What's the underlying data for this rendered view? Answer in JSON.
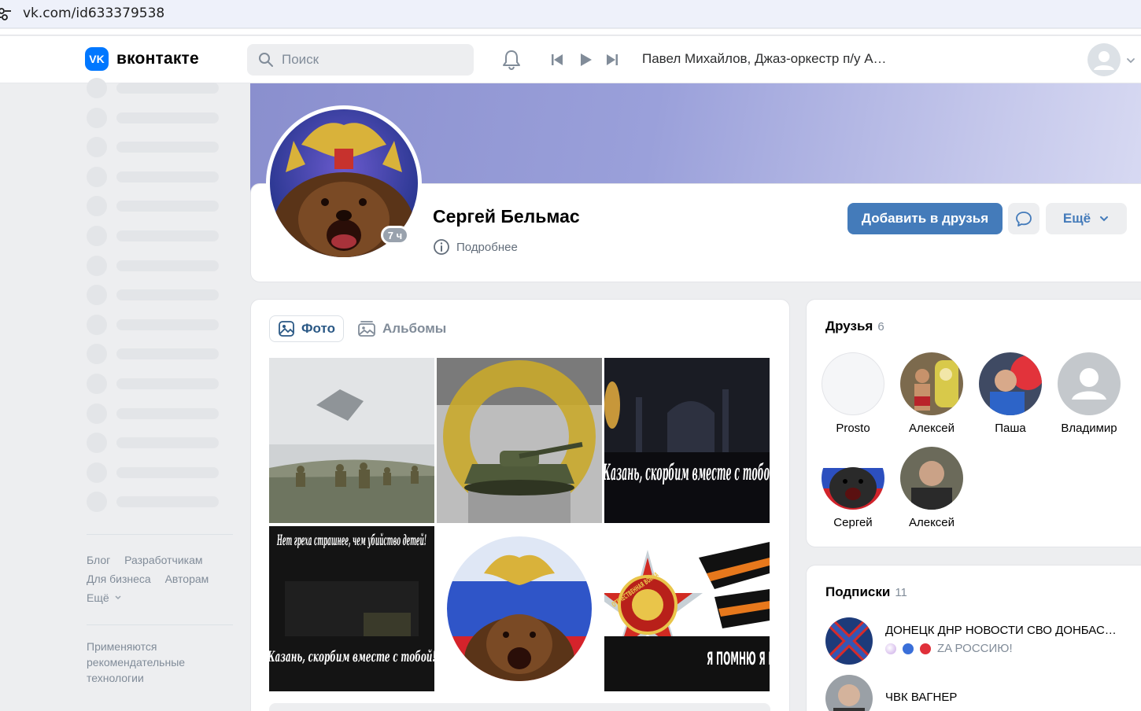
{
  "browser": {
    "url": "vk.com/id633379538"
  },
  "header": {
    "logo_text": "вконтакте",
    "logo_mark": "VK",
    "search_placeholder": "Поиск",
    "now_playing": "Павел Михайлов, Джаз-оркестр п/у А…",
    "icons": [
      "search-icon",
      "bell-icon",
      "prev-track-icon",
      "play-icon",
      "next-track-icon",
      "user-avatar-icon",
      "chevron-down-icon"
    ]
  },
  "sidebar": {
    "footer_links": [
      "Блог",
      "Разработчикам",
      "Для бизнеса",
      "Авторам",
      "Ещё"
    ],
    "recommendation_note": "Применяются рекомендательные технологии"
  },
  "profile": {
    "name": "Сергей Бельмас",
    "last_seen_badge": "7 ч",
    "details_link": "Подробнее",
    "add_friend_button": "Добавить в друзья",
    "more_button": "Ещё",
    "accent_color": "#447bba"
  },
  "photos": {
    "tabs": [
      {
        "label": "Фото",
        "active": true
      },
      {
        "label": "Альбомы",
        "active": false
      }
    ],
    "captions": {
      "kazan_1": "Казань, скорбим вместе с тобой",
      "kids_top": "Нет греха страшнее, чем убийство детей!",
      "kids_bottom": "Казань, скорбим вместе с тобой!",
      "war_ring": "ОТЕЧЕСТВЕННАЯ ВОЙНА",
      "war_text": "Я ПОМНЮ Я ГОРЖУСЬ"
    }
  },
  "friends": {
    "title": "Друзья",
    "count": "6",
    "items": [
      {
        "name": "Prosto"
      },
      {
        "name": "Алексей"
      },
      {
        "name": "Паша"
      },
      {
        "name": "Владимир"
      },
      {
        "name": "Сергей"
      },
      {
        "name": "Алексей"
      }
    ]
  },
  "subscriptions": {
    "title": "Подписки",
    "count": "11",
    "items": [
      {
        "title": "ДОНЕЦК ДНР НОВОСТИ СВО ДОНБАС…",
        "subtitle": "ZA РОССИЮ!"
      },
      {
        "title": "ЧВК ВАГНЕР",
        "subtitle": ""
      }
    ]
  }
}
